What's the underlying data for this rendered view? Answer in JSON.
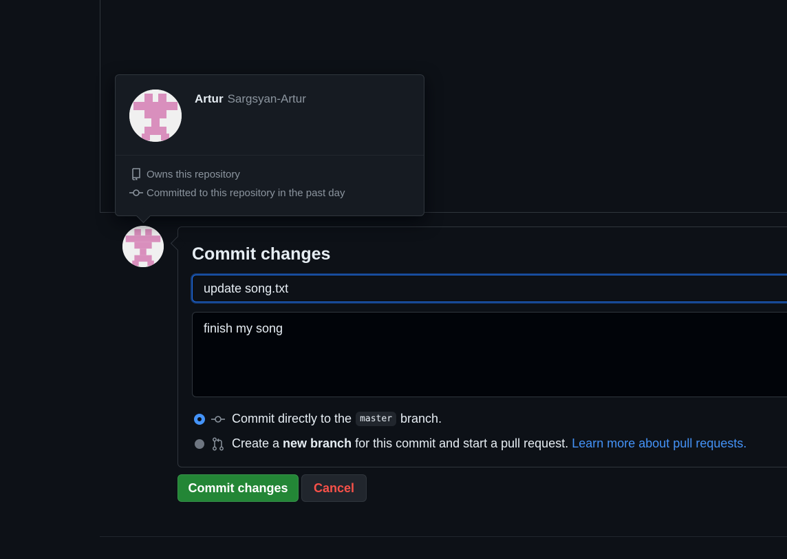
{
  "hovercard": {
    "name": "Artur",
    "login": "Sargsyan-Artur",
    "owns_text": "Owns this repository",
    "committed_text": "Committed to this repository in the past day",
    "avatar_icon": "identicon-avatar",
    "repo_icon": "repo-icon",
    "commit_icon": "git-commit-icon"
  },
  "commit_form": {
    "title": "Commit changes",
    "summary_value": "update song.txt",
    "description_value": "finish my song",
    "option_direct": {
      "prefix": "Commit directly to the",
      "branch": "master",
      "suffix": "branch.",
      "selected": true
    },
    "option_new_branch": {
      "prefix": "Create a",
      "bold": "new branch",
      "suffix": "for this commit and start a pull request.",
      "link": "Learn more about pull requests.",
      "selected": false
    }
  },
  "buttons": {
    "commit": "Commit changes",
    "cancel": "Cancel"
  },
  "colors": {
    "background": "#0d1117",
    "accent_blue": "#4493f8",
    "commit_green": "#238636",
    "cancel_red": "#f85149",
    "avatar_pink": "#d98fbd"
  }
}
